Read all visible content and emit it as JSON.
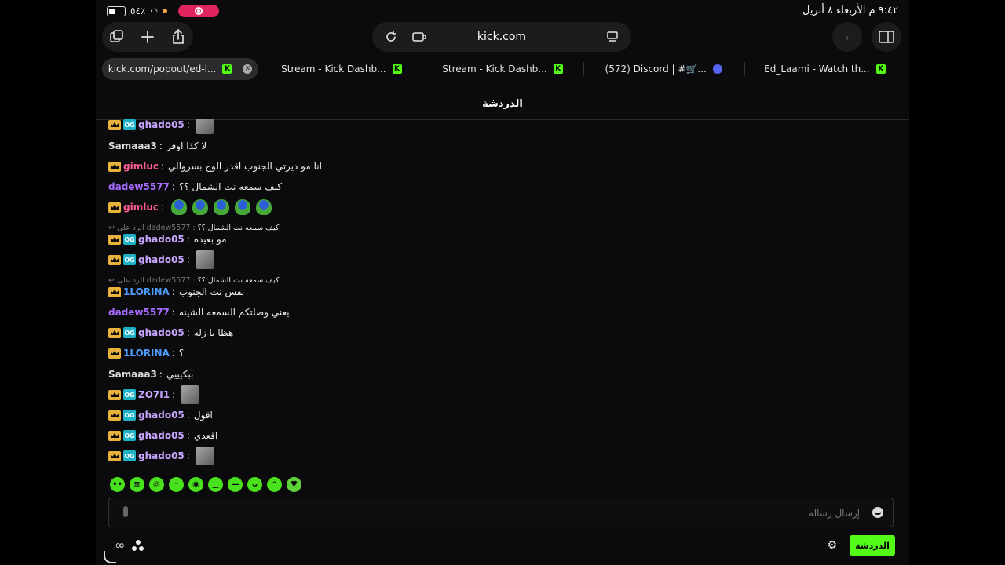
{
  "status": {
    "battery": "٥٤٪",
    "datetime": "٩:٤٢ م  الأربعاء ٨ أبريل"
  },
  "browser": {
    "url": "kick.com",
    "tabs": [
      {
        "label": "kick.com/popout/ed-l..."
      },
      {
        "label": "Stream - Kick Dashb..."
      },
      {
        "label": "Stream - Kick Dashb..."
      },
      {
        "label": "(572) Discord | #🛒..."
      },
      {
        "label": "Ed_Laami - Watch th..."
      }
    ]
  },
  "chat": {
    "title": "الدردشة",
    "messages": [
      {
        "user": "ghado05",
        "text": ""
      },
      {
        "user": "Samaaa3",
        "text": "لا كذا اوفر"
      },
      {
        "user": "gimluc",
        "text": "انا مو ديرتي الجنوب اقدر الوح بسروالي"
      },
      {
        "user": "dadew5577",
        "text": "كيف سمعه نت الشمال ؟؟"
      },
      {
        "user": "gimluc",
        "text": ""
      },
      {
        "reply_label": "الرد على",
        "reply_user": "dadew5577",
        "reply_text": "كيف سمعه نت الشمال ؟؟"
      },
      {
        "user": "ghado05",
        "text": "مو بعيده"
      },
      {
        "user": "ghado05",
        "text": ""
      },
      {
        "reply_label": "الرد على",
        "reply_user": "dadew5577",
        "reply_text": "كيف سمعه نت الشمال ؟؟"
      },
      {
        "user": "1LORINA",
        "text": "نفس نت الجنوب"
      },
      {
        "user": "dadew5577",
        "text": "يعني وصلتكم السمعه الشينه"
      },
      {
        "user": "ghado05",
        "text": "هظا يا زله"
      },
      {
        "user": "1LORINA",
        "text": "؟"
      },
      {
        "user": "Samaaa3",
        "text": "ببكيييي"
      },
      {
        "user": "ZO7I1",
        "text": ""
      },
      {
        "user": "ghado05",
        "text": "اقول"
      },
      {
        "user": "ghado05",
        "text": "اقعدي"
      },
      {
        "user": "ghado05",
        "text": ""
      }
    ],
    "badge_text": "OG",
    "input_placeholder": "إرسال رسالة",
    "send_label": "الدردشة"
  }
}
